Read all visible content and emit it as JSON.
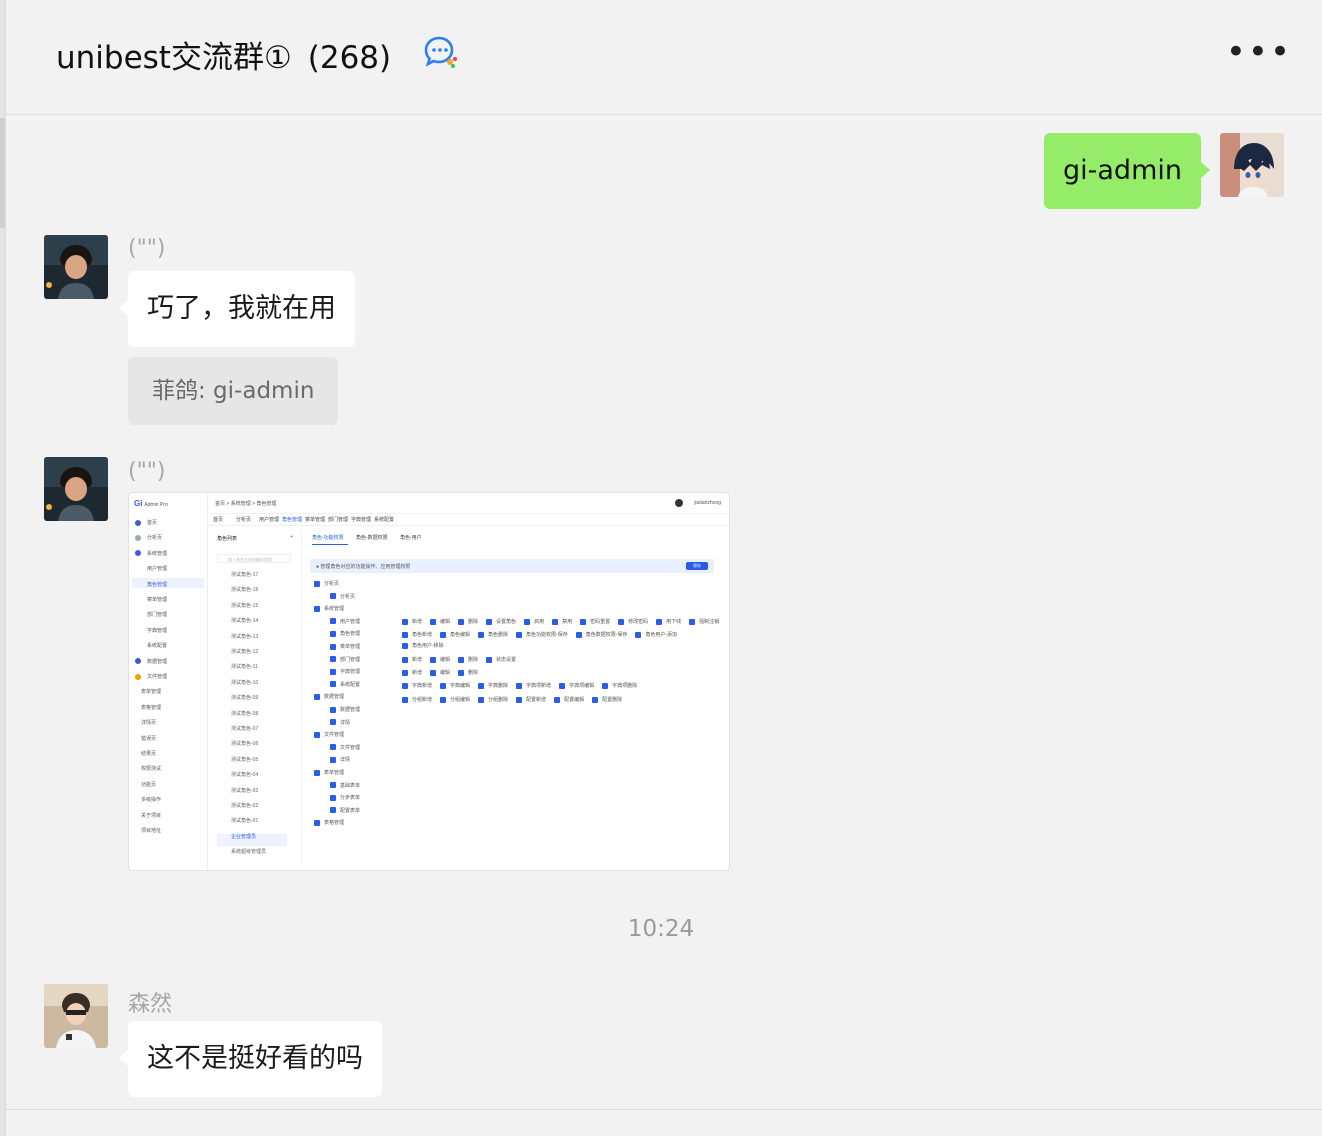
{
  "header": {
    "group_name": "unibest交流群①",
    "member_count": "(268)",
    "chat_icon": "chat-bubble-icon",
    "more_icon": "more-ellipsis-icon",
    "more_label": "•••"
  },
  "messages": {
    "outgoing": {
      "text": "gi-admin"
    },
    "msg1": {
      "sender": "(\"\")",
      "text": "巧了，我就在用",
      "quote": "菲鸽: gi-admin"
    },
    "msg2": {
      "sender": "(\"\")"
    },
    "timestamp": "10:24",
    "msg3": {
      "sender": "森然",
      "text": "这不是挺好看的吗"
    }
  },
  "screenshot": {
    "logo_mark": "Gi",
    "logo_text": "Admin Pro",
    "sidebar": [
      "首页",
      "分析页",
      "系统管理",
      "用户管理",
      "角色管理",
      "菜单管理",
      "部门管理",
      "字典管理",
      "系统配置",
      "数据管理",
      "文件管理",
      "表单管理",
      "表格管理",
      "详情页",
      "错误页",
      "结果页",
      "权限测试",
      "功能页",
      "多级操作",
      "关于项目",
      "项目地址"
    ],
    "breadcrumb": "首页  >  系统管理  >  角色管理",
    "user": "jiutianzhong",
    "tabs": [
      "首页",
      "分析页",
      "用户管理",
      "角色管理",
      "菜单管理",
      "部门管理",
      "字典管理",
      "系统配置"
    ],
    "role_list_title": "角色列表",
    "role_search_placeholder": "输入角色名称或编码搜索",
    "roles": [
      "测试角色-17",
      "测试角色-16",
      "测试角色-15",
      "测试角色-14",
      "测试角色-13",
      "测试角色-12",
      "测试角色-11",
      "测试角色-10",
      "测试角色-09",
      "测试角色-08",
      "测试角色-07",
      "测试角色-06",
      "测试角色-05",
      "测试角色-04",
      "测试角色-03",
      "测试角色-02",
      "测试角色-01",
      "企业管理员",
      "系统超级管理员"
    ],
    "perm_tabs": [
      "角色-功能权限",
      "角色-数据权限",
      "角色-用户"
    ],
    "info_text": "管理角色对应的功能操作、应用管理权限",
    "save_label": "保存",
    "tree": [
      "分析页",
      "分析页",
      "系统管理",
      "用户管理",
      "角色管理",
      "菜单管理",
      "部门管理",
      "字典管理",
      "系统配置",
      "数据管理",
      "数据管理",
      "详情",
      "文件管理",
      "文件管理",
      "详情",
      "表单管理",
      "基础表单",
      "分步表单",
      "配置表单",
      "表格管理"
    ],
    "perm_rows": [
      [
        "新增",
        "编辑",
        "删除",
        "设置角色",
        "启用",
        "禁用",
        "密码重置",
        "修改密码",
        "用下线",
        "强制注销"
      ],
      [
        "角色新增",
        "角色编辑",
        "角色删除",
        "角色功能权限-保存",
        "角色数据权限-保存",
        "角色用户-添加"
      ],
      [
        "角色用户-移除"
      ],
      [
        "新增",
        "编辑",
        "删除",
        "状态设置"
      ],
      [
        "新增",
        "编辑",
        "删除"
      ],
      [
        "字典新增",
        "字典编辑",
        "字典删除",
        "字典项新增",
        "字典项编辑",
        "字典项删除"
      ],
      [
        "分组新增",
        "分组编辑",
        "分组删除",
        "配置新增",
        "配置编辑",
        "配置删除"
      ]
    ]
  },
  "colors": {
    "outgoing_bubble": "#95ec69",
    "incoming_bubble": "#ffffff",
    "background": "#f2f2f2",
    "accent": "#2b5ce6"
  }
}
